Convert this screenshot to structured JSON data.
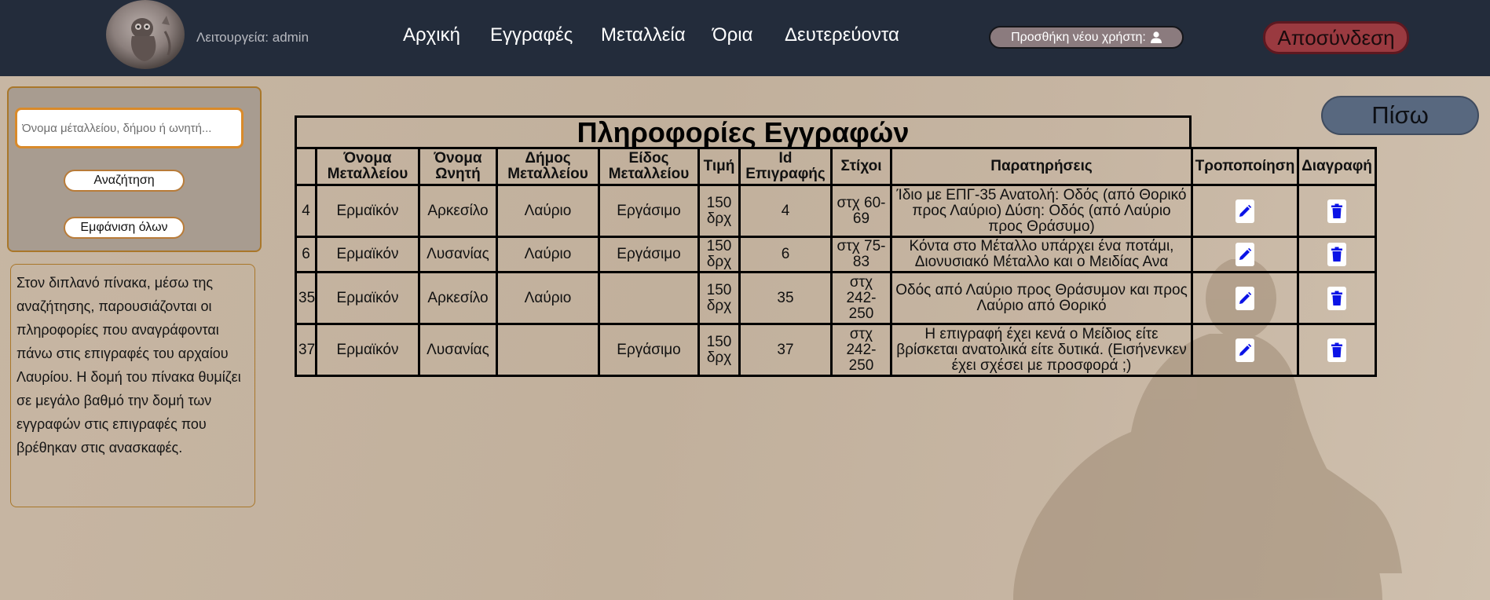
{
  "header": {
    "role_text": "Λειτουργεία: admin",
    "nav": [
      "Αρχική",
      "Εγγραφές",
      "Μεταλλεία",
      "Όρια",
      "Δευτερεύοντα"
    ],
    "add_user_label": "Προσθήκη νέου χρήστη:",
    "logout_label": "Αποσύνδεση"
  },
  "sidebar": {
    "search_placeholder": "Όνομα μέταλλείου, δήμου ή ωνητή...",
    "search_button": "Αναζήτηση",
    "show_all_button": "Εμφάνιση όλων",
    "info_text": "Στον διπλανό πίνακα, μέσω της αναζήτησης, παρουσιάζονται οι πληροφορίες που αναγράφονται πάνω στις επιγραφές του αρχαίου Λαυρίου. Η δομή του πίνακα θυμίζει σε μεγάλο βαθμό την δομή των εγγραφών στις επιγραφές που βρέθηκαν στις ανασκαφές."
  },
  "back_button": "Πίσω",
  "table": {
    "title": "Πληροφορίες Εγγραφών",
    "headers": [
      "",
      "Όνομα Μεταλλείου",
      "Όνομα Ωνητή",
      "Δήμος Μεταλλείου",
      "Είδος Μεταλλείου",
      "Τιμή",
      "Id Επιγραφής",
      "Στίχοι",
      "Παρατηρήσεις",
      "Τροποποίηση",
      "Διαγραφή"
    ],
    "rows": [
      {
        "id": "4",
        "mine": "Ερμαϊκόν",
        "buyer": "Αρκεσίλο",
        "deme": "Λαύριο",
        "type": "Εργάσιμο",
        "price": "150 δρχ",
        "inscription_id": "4",
        "lines": "στχ 60-69",
        "notes": "Ίδιο με ΕΠΓ-35 Ανατολή: Οδός (από Θορικό προς Λαύριο) Δύση: Οδός (από Λαύριο προς Θράσυμο)"
      },
      {
        "id": "6",
        "mine": "Ερμαϊκόν",
        "buyer": "Λυσανίας",
        "deme": "Λαύριο",
        "type": "Εργάσιμο",
        "price": "150 δρχ",
        "inscription_id": "6",
        "lines": "στχ 75-83",
        "notes": "Κόντα στο Μέταλλο υπάρχει ένα ποτάμι, Διονυσιακό Μέταλλο και ο Μειδίας Ανα"
      },
      {
        "id": "35",
        "mine": "Ερμαϊκόν",
        "buyer": "Αρκεσίλο",
        "deme": "Λαύριο",
        "type": "",
        "price": "150 δρχ",
        "inscription_id": "35",
        "lines": "στχ 242-250",
        "notes": "Οδός από Λαύριο προς Θράσυμον και προς Λαύριο από Θορικό"
      },
      {
        "id": "37",
        "mine": "Ερμαϊκόν",
        "buyer": "Λυσανίας",
        "deme": "",
        "type": "Εργάσιμο",
        "price": "150 δρχ",
        "inscription_id": "37",
        "lines": "στχ 242-250",
        "notes": "Η επιγραφή έχει κενά ο Μείδιος είτε βρίσκεται ανατολικά είτε δυτικά. (Εισήνενκεν έχει σχέσει με προσφορά ;)"
      }
    ]
  },
  "icons": {
    "edit": "pencil-icon",
    "delete": "trash-icon",
    "user": "user-icon"
  },
  "colors": {
    "topbar": "#232c3b",
    "logout_bg": "#9a3a40",
    "back_bg": "#58687f",
    "icon_blue": "#0b13e6",
    "panel_border": "#a9772a"
  }
}
